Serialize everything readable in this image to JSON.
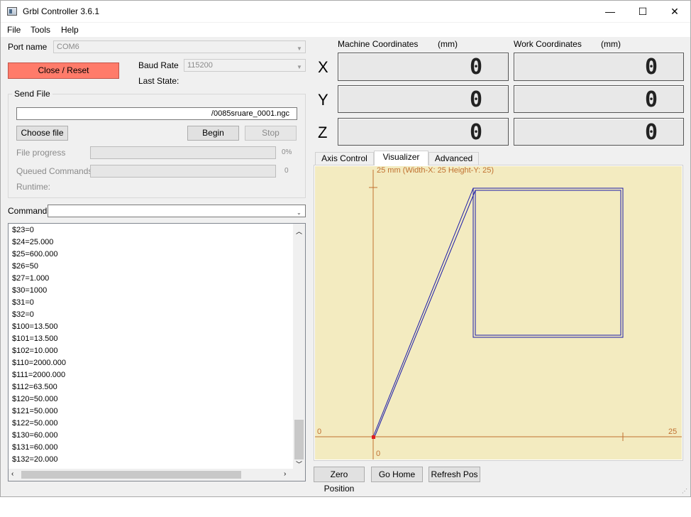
{
  "window": {
    "title": "Grbl Controller 3.6.1"
  },
  "window_controls": {
    "minimize": "—",
    "maximize": "☐",
    "close": "✕"
  },
  "menu": {
    "file": "File",
    "tools": "Tools",
    "help": "Help"
  },
  "port": {
    "label": "Port name",
    "value": "COM6"
  },
  "baud": {
    "label": "Baud Rate",
    "value": "115200"
  },
  "last_state": {
    "label": "Last State:"
  },
  "close_reset_label": "Close / Reset",
  "send_file": {
    "title": "Send File",
    "path": "/0085sruare_0001.ngc",
    "choose_label": "Choose file",
    "begin_label": "Begin",
    "stop_label": "Stop",
    "progress_label": "File progress",
    "progress_value": "0%",
    "queued_label": "Queued Commands",
    "queued_value": "0",
    "runtime_label": "Runtime:"
  },
  "command": {
    "label": "Command",
    "value": ""
  },
  "console_lines": [
    "$23=0",
    "$24=25.000",
    "$25=600.000",
    "$26=50",
    "$27=1.000",
    "$30=1000",
    "$31=0",
    "$32=0",
    "$100=13.500",
    "$101=13.500",
    "$102=10.000",
    "$110=2000.000",
    "$111=2000.000",
    "$112=63.500",
    "$120=50.000",
    "$121=50.000",
    "$122=50.000",
    "$130=60.000",
    "$131=60.000",
    "$132=20.000"
  ],
  "coords": {
    "machine_label": "Machine Coordinates",
    "machine_unit": "(mm)",
    "work_label": "Work Coordinates",
    "work_unit": "(mm)",
    "axes": [
      {
        "name": "X",
        "machine": "0",
        "work": "0"
      },
      {
        "name": "Y",
        "machine": "0",
        "work": "0"
      },
      {
        "name": "Z",
        "machine": "0",
        "work": "0"
      }
    ]
  },
  "tabs": {
    "axis_control": "Axis Control",
    "visualizer": "Visualizer",
    "advanced": "Advanced"
  },
  "visualizer": {
    "header": "25 mm  (Width-X: 25  Height-Y: 25)",
    "origin_x_label": "0",
    "max_x_label": "25",
    "origin_y_label": "0",
    "bg_color": "#f3ebc0",
    "axis_color": "#c07030",
    "path_color": "#1a1aa8"
  },
  "bottom_buttons": {
    "zero": "Zero Position",
    "home": "Go Home",
    "refresh": "Refresh Pos"
  }
}
